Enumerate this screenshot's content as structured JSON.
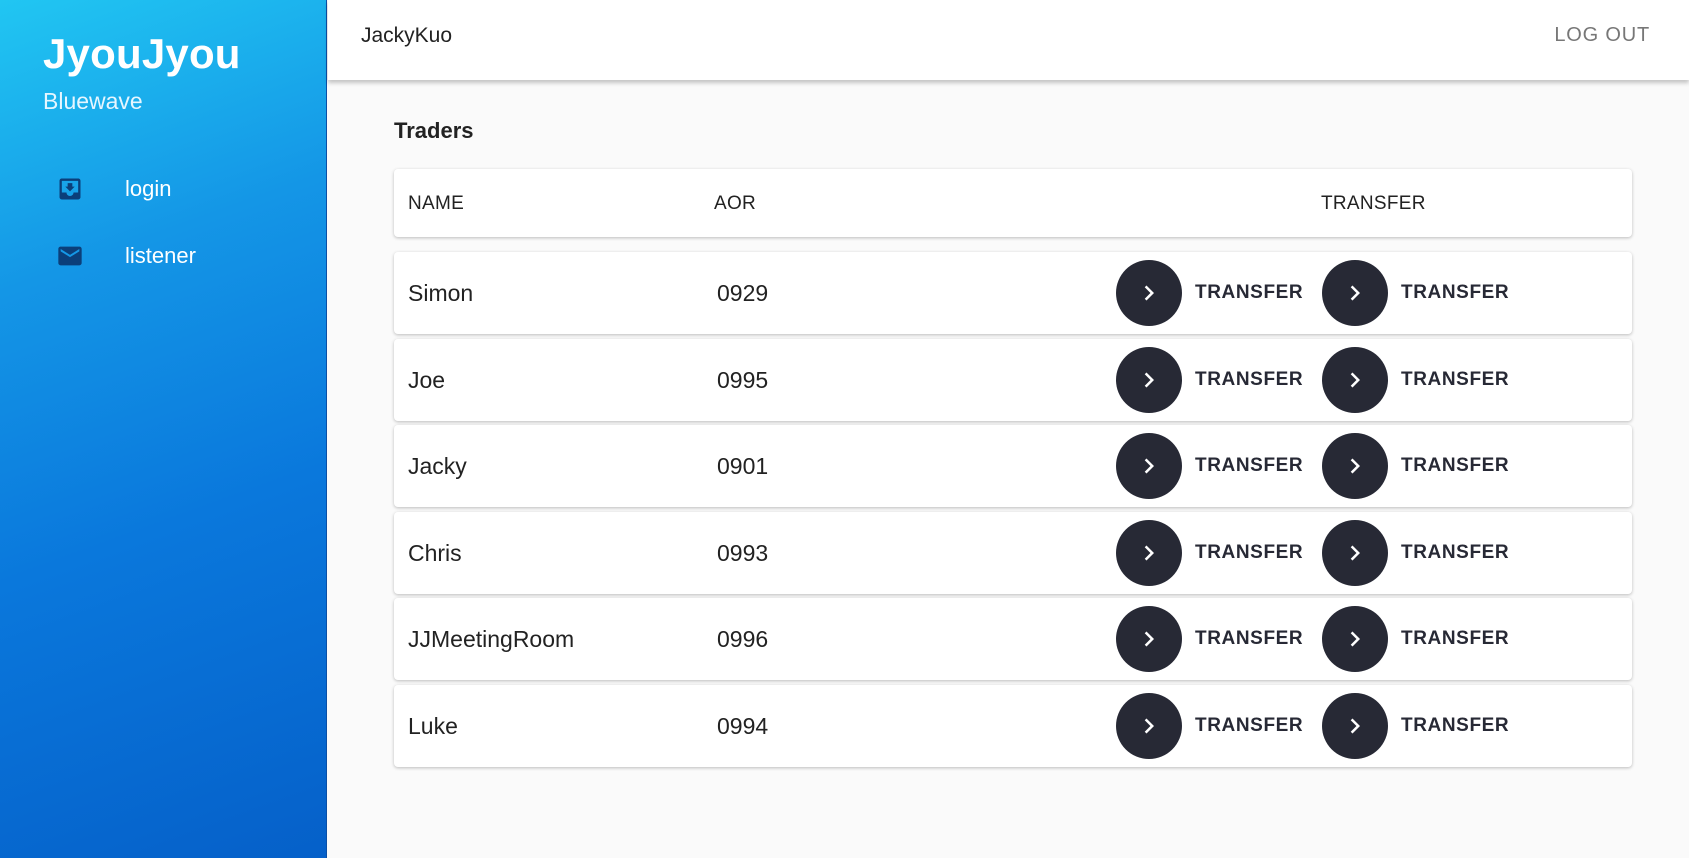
{
  "sidebar": {
    "brand_title": "JyouJyou",
    "brand_subtitle": "Bluewave",
    "items": [
      {
        "label": "login",
        "icon": "login-inbox-icon"
      },
      {
        "label": "listener",
        "icon": "mail-icon"
      }
    ]
  },
  "header": {
    "user": "JackyKuo",
    "logout_label": "LOG OUT"
  },
  "main": {
    "section_title": "Traders",
    "columns": {
      "name": "NAME",
      "aor": "AOR",
      "transfer": "TRANSFER"
    },
    "rows": [
      {
        "name": "Simon",
        "aor": "0929",
        "transfer_1": "TRANSFER",
        "transfer_2": "TRANSFER"
      },
      {
        "name": "Joe",
        "aor": "0995",
        "transfer_1": "TRANSFER",
        "transfer_2": "TRANSFER"
      },
      {
        "name": "Jacky",
        "aor": "0901",
        "transfer_1": "TRANSFER",
        "transfer_2": "TRANSFER"
      },
      {
        "name": "Chris",
        "aor": "0993",
        "transfer_1": "TRANSFER",
        "transfer_2": "TRANSFER"
      },
      {
        "name": "JJMeetingRoom",
        "aor": "0996",
        "transfer_1": "TRANSFER",
        "transfer_2": "TRANSFER"
      },
      {
        "name": "Luke",
        "aor": "0994",
        "transfer_1": "TRANSFER",
        "transfer_2": "TRANSFER"
      }
    ]
  },
  "colors": {
    "sidebar_gradient_start": "#21c6f2",
    "sidebar_gradient_end": "#0560c9",
    "button_dark": "#272935",
    "background": "#fafafa"
  }
}
